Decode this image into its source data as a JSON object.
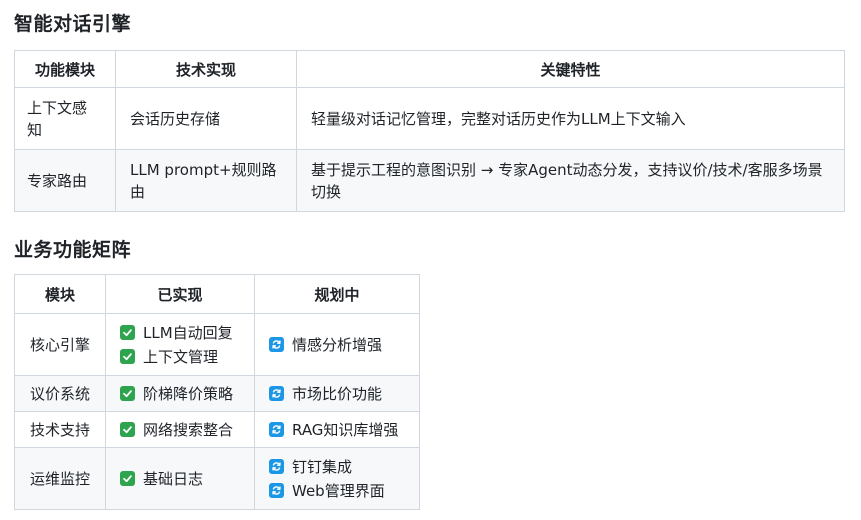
{
  "section1": {
    "title": "智能对话引擎",
    "headers": [
      "功能模块",
      "技术实现",
      "关键特性"
    ],
    "rows": [
      {
        "module": "上下文感知",
        "tech": "会话历史存储",
        "feature": "轻量级对话记忆管理，完整对话历史作为LLM上下文输入"
      },
      {
        "module": "专家路由",
        "tech": "LLM prompt+规则路由",
        "feature": "基于提示工程的意图识别 → 专家Agent动态分发，支持议价/技术/客服多场景切换"
      }
    ]
  },
  "section2": {
    "title": "业务功能矩阵",
    "headers": [
      "模块",
      "已实现",
      "规划中"
    ],
    "rows": [
      {
        "module": "核心引擎",
        "done": [
          "LLM自动回复",
          "上下文管理"
        ],
        "planned": [
          "情感分析增强"
        ]
      },
      {
        "module": "议价系统",
        "done": [
          "阶梯降价策略"
        ],
        "planned": [
          "市场比价功能"
        ]
      },
      {
        "module": "技术支持",
        "done": [
          "网络搜索整合"
        ],
        "planned": [
          "RAG知识库增强"
        ]
      },
      {
        "module": "运维监控",
        "done": [
          "基础日志"
        ],
        "planned": [
          "钉钉集成",
          "Web管理界面"
        ]
      }
    ]
  },
  "icons": {
    "done": "check-box-icon",
    "planned": "refresh-icon",
    "done_color": "#2ea44f",
    "planned_color": "#1c97e6"
  }
}
